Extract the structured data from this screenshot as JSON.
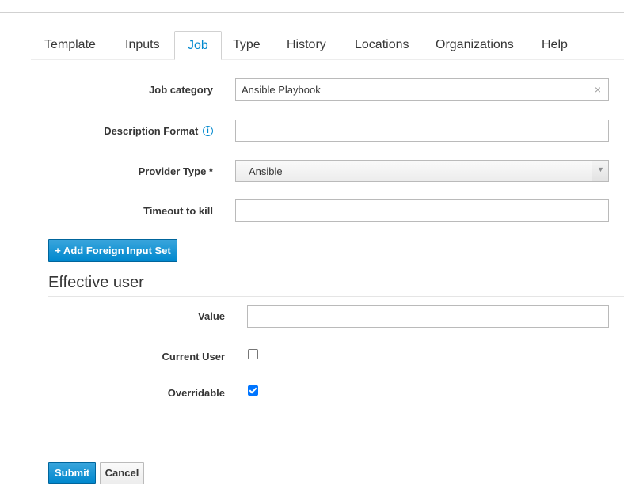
{
  "tabs": [
    {
      "label": "Template"
    },
    {
      "label": "Inputs"
    },
    {
      "label": "Job"
    },
    {
      "label": "Type"
    },
    {
      "label": "History"
    },
    {
      "label": "Locations"
    },
    {
      "label": "Organizations"
    },
    {
      "label": "Help"
    }
  ],
  "active_tab": "Job",
  "form": {
    "job_category": {
      "label": "Job category",
      "value": "Ansible Playbook",
      "clear": "×"
    },
    "description_format": {
      "label": "Description Format",
      "value": "",
      "info_icon": "i"
    },
    "provider_type": {
      "label": "Provider Type *",
      "value": "Ansible",
      "arrow": "▼"
    },
    "timeout": {
      "label": "Timeout to kill",
      "value": ""
    },
    "add_foreign_button": "+ Add Foreign Input Set"
  },
  "effective_user": {
    "title": "Effective user",
    "value": {
      "label": "Value",
      "value": ""
    },
    "current_user": {
      "label": "Current User",
      "checked": false
    },
    "overridable": {
      "label": "Overridable",
      "checked": true
    }
  },
  "actions": {
    "submit": "Submit",
    "cancel": "Cancel"
  },
  "colors": {
    "accent": "#0088ce",
    "checkbox": "#0075ff"
  }
}
